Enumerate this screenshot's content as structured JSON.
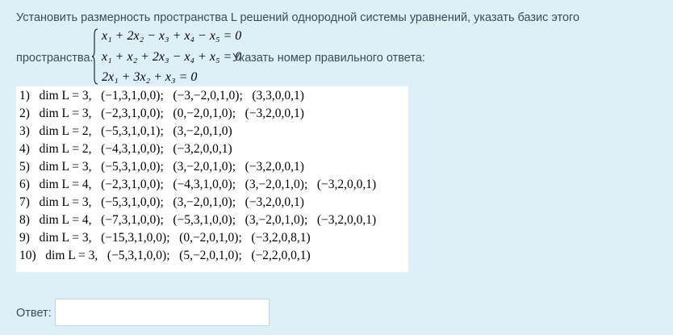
{
  "question": {
    "line1": "Установить размерность пространства L решений однородной системы уравнений, указать базис этого",
    "prefix": "пространства.",
    "suffix": "Указать номер правильного ответа:",
    "equations": [
      "x₁ + 2x₂ − x₃ + x₄ − x₅ = 0",
      "x₁ + x₂ + 2x₃ − x₄ + x₅ = 0",
      "2x₁ + 3x₂ + x₃ = 0"
    ]
  },
  "options": [
    "1)   dim L = 3,   (−1,3,1,0,0);   (−3,−2,0,1,0);   (3,3,0,0,1)",
    "2)   dim L = 3,   (−2,3,1,0,0);   (0,−2,0,1,0);   (−3,2,0,0,1)",
    "3)   dim L = 2,   (−5,3,1,0,1);   (3,−2,0,1,0)",
    "4)   dim L = 2,   (−4,3,1,0,0);   (−3,2,0,0,1)",
    "5)   dim L = 3,   (−5,3,1,0,0);   (3,−2,0,1,0);   (−3,2,0,0,1)",
    "6)   dim L = 4,   (−2,3,1,0,0);   (−4,3,1,0,0);   (3,−2,0,1,0);   (−3,2,0,0,1)",
    "7)   dim L = 3,   (−5,3,1,0,0);   (3,−2,0,1,0);   (−3,2,0,0,1)",
    "8)   dim L = 4,   (−7,3,1,0,0);   (−5,3,1,0,0);   (3,−2,0,1,0);   (−3,2,0,0,1)",
    "9)   dim L = 3,   (−15,3,1,0,0);   (0,−2,0,1,0);   (−3,2,0,8,1)",
    "10)   dim L = 3,   (−5,3,1,0,0);   (5,−2,0,1,0);   (−2,2,0,0,1)"
  ],
  "answer": {
    "label": "Ответ:",
    "value": ""
  }
}
